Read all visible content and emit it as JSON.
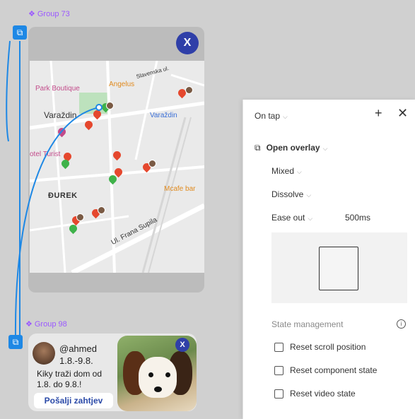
{
  "canvas": {
    "group73_label": "Group 73",
    "group98_label": "Group 98"
  },
  "map": {
    "close_label": "X",
    "labels": {
      "park_boutique": "Park Boutique",
      "angelus": "Angelus",
      "slavenska": "Slavenska ul.",
      "varazdin": "Varaždin",
      "varazdin_station": "Varaždin",
      "hotel_turist": "otel Turist",
      "durek": "ĐUREK",
      "mcafe": "Mcafe bar",
      "ulica": "Ul. Frana Supila"
    }
  },
  "card": {
    "username": "@ahmed",
    "dates": "1.8.-9.8.",
    "line1": "Kiky traži dom od",
    "line2": "1.8. do 9.8.!",
    "request_button": "Pošalji zahtjev",
    "close_label": "X"
  },
  "panel": {
    "trigger": "On tap",
    "action": "Open overlay",
    "position": "Mixed",
    "animation": "Dissolve",
    "easing": "Ease out",
    "duration": "500ms",
    "state_management": "State management",
    "options": [
      "Reset scroll position",
      "Reset component state",
      "Reset video state"
    ]
  },
  "colors": {
    "accent": "#1e88e5",
    "frame_label": "#9b59ff",
    "close_button": "#2f3fa8"
  }
}
